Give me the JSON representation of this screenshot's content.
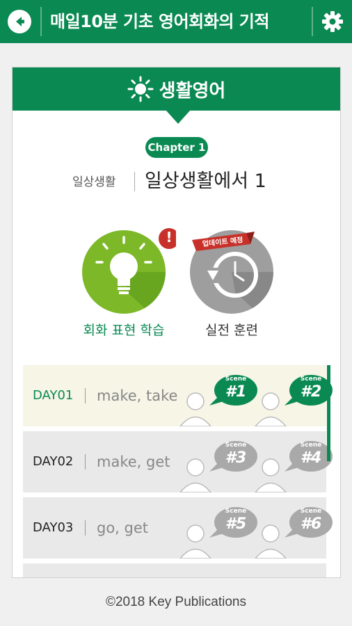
{
  "appbar": {
    "title": "매일10분 기초 영어회화의 기적"
  },
  "card": {
    "header": "생활영어",
    "chapter_pill": "Chapter 1",
    "chapter_sub": "일상생활",
    "chapter_title": "일상생활에서 1"
  },
  "modes": [
    {
      "label": "회화 표현 학습",
      "badge": "!"
    },
    {
      "label": "실전 훈련",
      "ribbon": "업데이트 예정"
    }
  ],
  "days": [
    {
      "day": "DAY01",
      "words": "make, take",
      "scenes": [
        {
          "label": "Scene",
          "num": "#1"
        },
        {
          "label": "Scene",
          "num": "#2"
        }
      ]
    },
    {
      "day": "DAY02",
      "words": "make, get",
      "scenes": [
        {
          "label": "Scene",
          "num": "#3"
        },
        {
          "label": "Scene",
          "num": "#4"
        }
      ]
    },
    {
      "day": "DAY03",
      "words": "go, get",
      "scenes": [
        {
          "label": "Scene",
          "num": "#5"
        },
        {
          "label": "Scene",
          "num": "#6"
        }
      ]
    }
  ],
  "footer": "©2018 Key Publications",
  "colors": {
    "primary": "#0a8a52",
    "lime": "#7cb828",
    "grey_icon": "#9e9e9e",
    "ribbon": "#c8312a",
    "active_row": "#f6f5e6"
  }
}
